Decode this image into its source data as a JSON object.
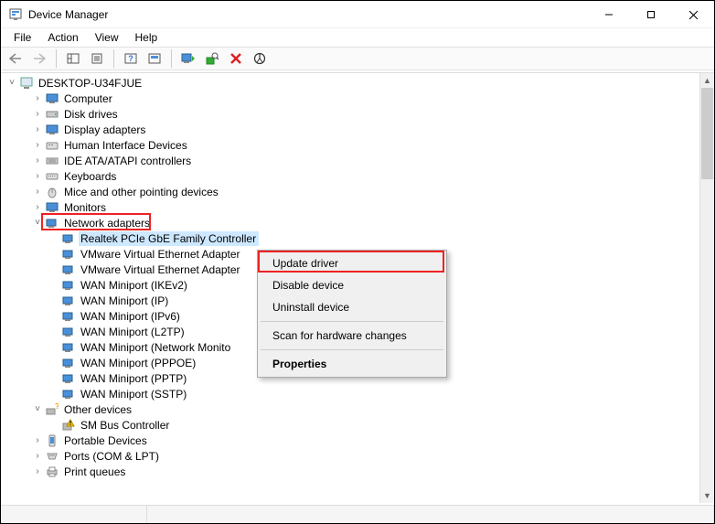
{
  "window": {
    "title": "Device Manager"
  },
  "menu": {
    "file": "File",
    "action": "Action",
    "view": "View",
    "help": "Help"
  },
  "tree": {
    "root": "DESKTOP-U34FJUE",
    "nodes": [
      {
        "label": "Computer",
        "icon": "monitor"
      },
      {
        "label": "Disk drives",
        "icon": "disk"
      },
      {
        "label": "Display adapters",
        "icon": "monitor"
      },
      {
        "label": "Human Interface Devices",
        "icon": "hid"
      },
      {
        "label": "IDE ATA/ATAPI controllers",
        "icon": "ide"
      },
      {
        "label": "Keyboards",
        "icon": "keyboard"
      },
      {
        "label": "Mice and other pointing devices",
        "icon": "mouse"
      },
      {
        "label": "Monitors",
        "icon": "monitor"
      }
    ],
    "network": {
      "label": "Network adapters",
      "children": [
        "Realtek PCIe GbE Family Controller",
        "VMware Virtual Ethernet Adapter",
        "VMware Virtual Ethernet Adapter",
        "WAN Miniport (IKEv2)",
        "WAN Miniport (IP)",
        "WAN Miniport (IPv6)",
        "WAN Miniport (L2TP)",
        "WAN Miniport (Network Monito",
        "WAN Miniport (PPPOE)",
        "WAN Miniport (PPTP)",
        "WAN Miniport (SSTP)"
      ]
    },
    "other_devices": {
      "label": "Other devices",
      "child": "SM Bus Controller"
    },
    "trailing": [
      {
        "label": "Portable Devices",
        "icon": "portable"
      },
      {
        "label": "Ports (COM & LPT)",
        "icon": "ports"
      },
      {
        "label": "Print queues",
        "icon": "printer"
      }
    ]
  },
  "context_menu": {
    "update": "Update driver",
    "disable": "Disable device",
    "uninstall": "Uninstall device",
    "scan": "Scan for hardware changes",
    "properties": "Properties"
  }
}
